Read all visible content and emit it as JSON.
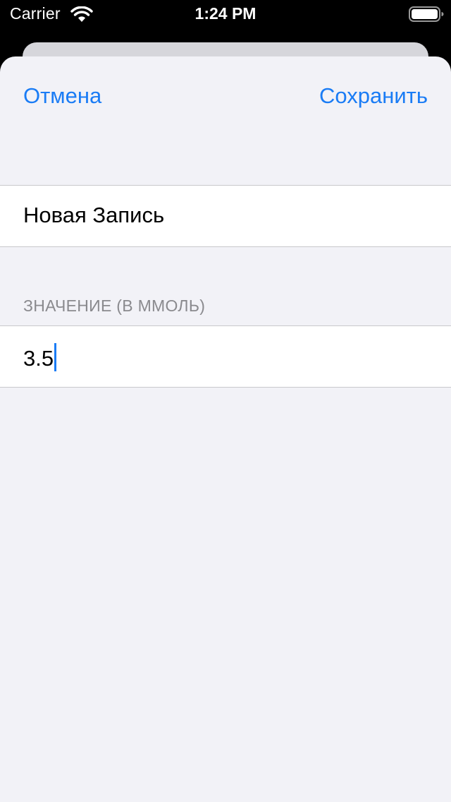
{
  "status_bar": {
    "carrier": "Carrier",
    "time": "1:24 PM",
    "icons": [
      "wifi-icon",
      "battery-icon"
    ]
  },
  "nav": {
    "cancel_label": "Отмена",
    "save_label": "Сохранить"
  },
  "form": {
    "title_value": "Новая Запись",
    "value_section_header": "ЗНАЧЕНИЕ (В ММОЛЬ)",
    "value_input": "3.5"
  },
  "colors": {
    "accent": "#1a7cf5",
    "sheet_background": "#f2f2f7",
    "section_header": "#8a8a8e"
  }
}
